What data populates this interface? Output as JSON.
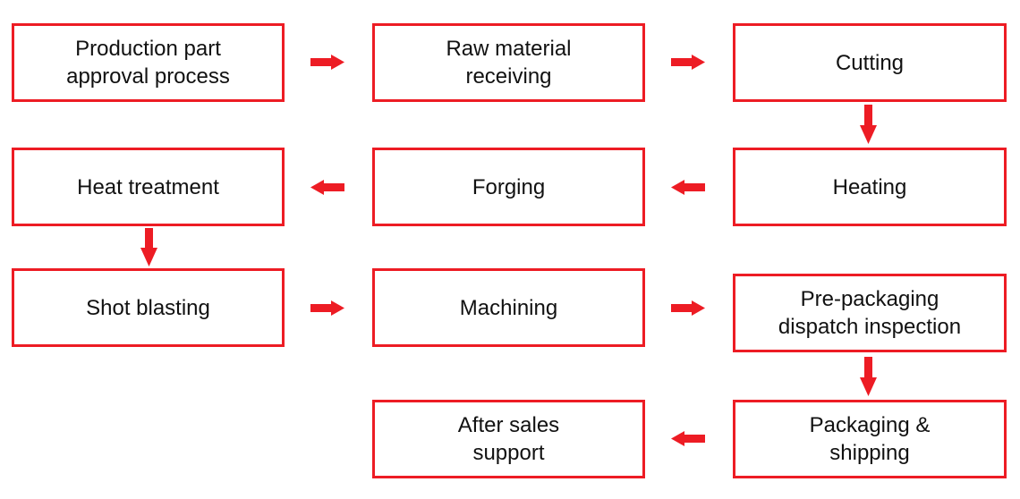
{
  "colors": {
    "accent": "#ED1C24",
    "text": "#111111"
  },
  "steps": [
    "Production part\napproval process",
    "Raw material\nreceiving",
    "Cutting",
    "Heating",
    "Forging",
    "Heat treatment",
    "Shot blasting",
    "Machining",
    "Pre-packaging\ndispatch inspection",
    "Packaging &\nshipping",
    "After sales\nsupport"
  ]
}
